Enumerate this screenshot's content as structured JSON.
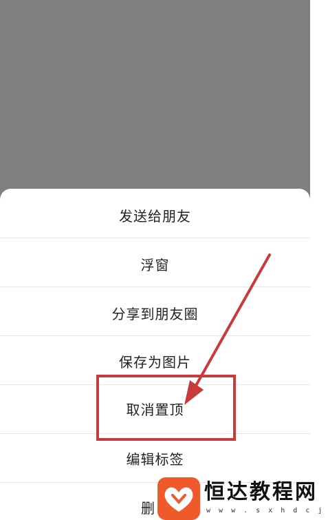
{
  "menu": {
    "items": [
      {
        "label": "发送给朋友"
      },
      {
        "label": "浮窗"
      },
      {
        "label": "分享到朋友圈"
      },
      {
        "label": "保存为图片"
      },
      {
        "label": "取消置顶"
      },
      {
        "label": "编辑标签"
      },
      {
        "label": "删"
      }
    ]
  },
  "annotation": {
    "highlighted_item": "取消置顶",
    "color": "#c93a3a"
  },
  "watermark": {
    "title": "恒达教程网",
    "url": "w w w . s x h d c j . c o m",
    "logo_icon": "heart-logo-icon",
    "logo_color": "#ef5a2a"
  },
  "colors": {
    "backdrop": "#7f7f7f",
    "sheet": "#ffffff",
    "text": "#222222",
    "divider": "#e6e6e6"
  }
}
